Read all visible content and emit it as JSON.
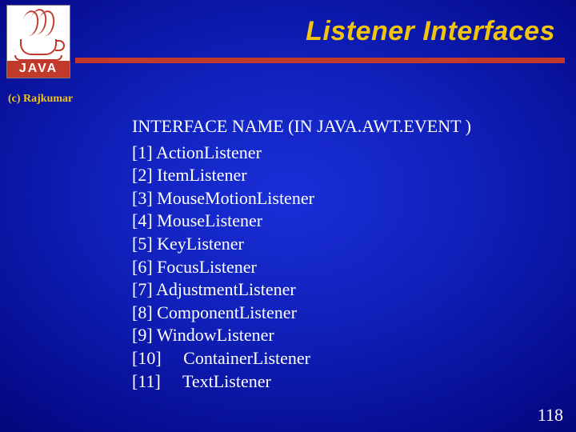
{
  "logo": {
    "text": "JAVA"
  },
  "title": "Listener Interfaces",
  "copyright": "(c) Rajkumar",
  "heading": "INTERFACE NAME (IN JAVA.AWT.EVENT )",
  "items": [
    "[1] ActionListener",
    "[2] ItemListener",
    "[3] MouseMotionListener",
    "[4] MouseListener",
    "[5] KeyListener",
    "[6] FocusListener",
    "[7] AdjustmentListener",
    "[8] ComponentListener",
    "[9] WindowListener",
    "[10]     ContainerListener",
    "[11]     TextListener"
  ],
  "page_number": "118"
}
